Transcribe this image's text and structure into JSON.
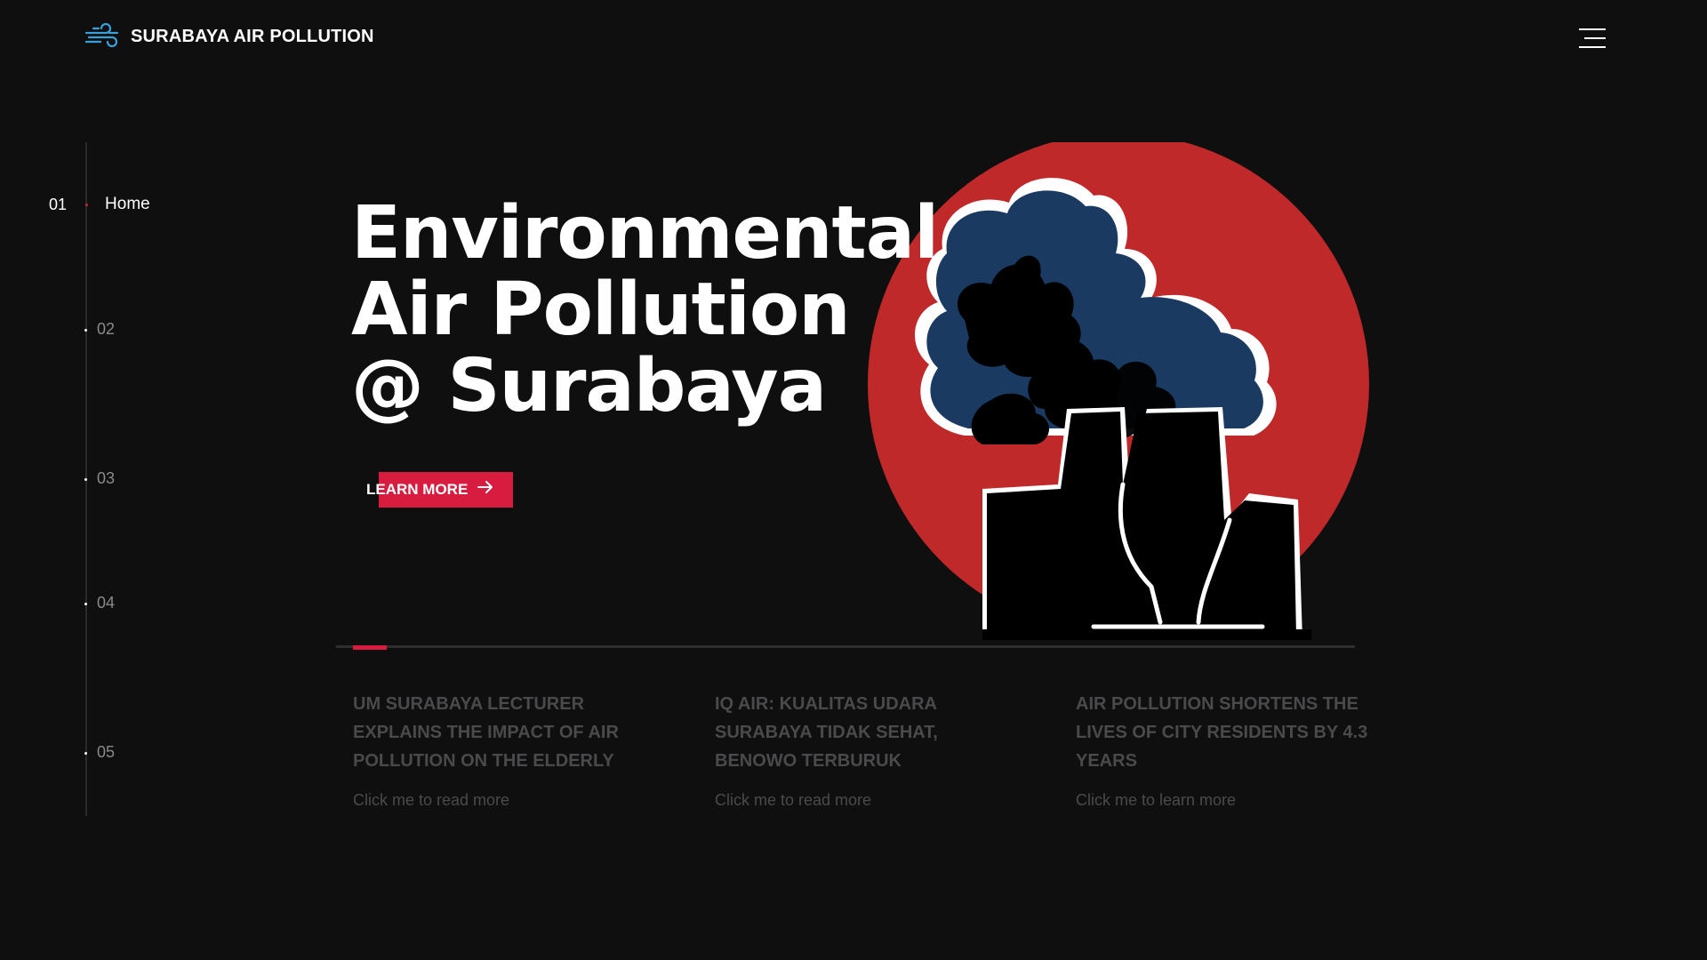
{
  "header": {
    "title": "SURABAYA AIR POLLUTION",
    "logo_icon": "wind-icon",
    "menu_icon": "hamburger-menu-icon"
  },
  "sidenav": {
    "items": [
      {
        "number": "01",
        "label": "Home",
        "active": true
      },
      {
        "number": "02",
        "label": "",
        "active": false
      },
      {
        "number": "03",
        "label": "",
        "active": false
      },
      {
        "number": "04",
        "label": "",
        "active": false
      },
      {
        "number": "05",
        "label": "",
        "active": false
      }
    ]
  },
  "hero": {
    "title_lines": [
      "Environmental",
      "Air Pollution",
      "@ Surabaya"
    ],
    "cta_label": "LEARN MORE",
    "cta_icon": "arrow-right-icon",
    "illustration": "factory-smoke-illustration"
  },
  "slider": {
    "progress": 0.033
  },
  "news": [
    {
      "title": "UM SURABAYA LECTURER EXPLAINS THE IMPACT OF AIR POLLUTION ON THE ELDERLY",
      "link": "Click me to read more"
    },
    {
      "title": "IQ AIR: KUALITAS UDARA SURABAYA TIDAK SEHAT, BENOWO TERBURUK",
      "link": "Click me to read more"
    },
    {
      "title": "AIR POLLUTION SHORTENS THE LIVES OF CITY RESIDENTS BY 4.3 YEARS",
      "link": "Click me to learn more"
    }
  ],
  "colors": {
    "background": "#0f0f10",
    "accent": "#d81c3f",
    "sun": "#c0292a",
    "smoke_blue": "#1a3a62",
    "muted_text": "#4a4a4c",
    "logo_blue": "#3aa0d8"
  }
}
